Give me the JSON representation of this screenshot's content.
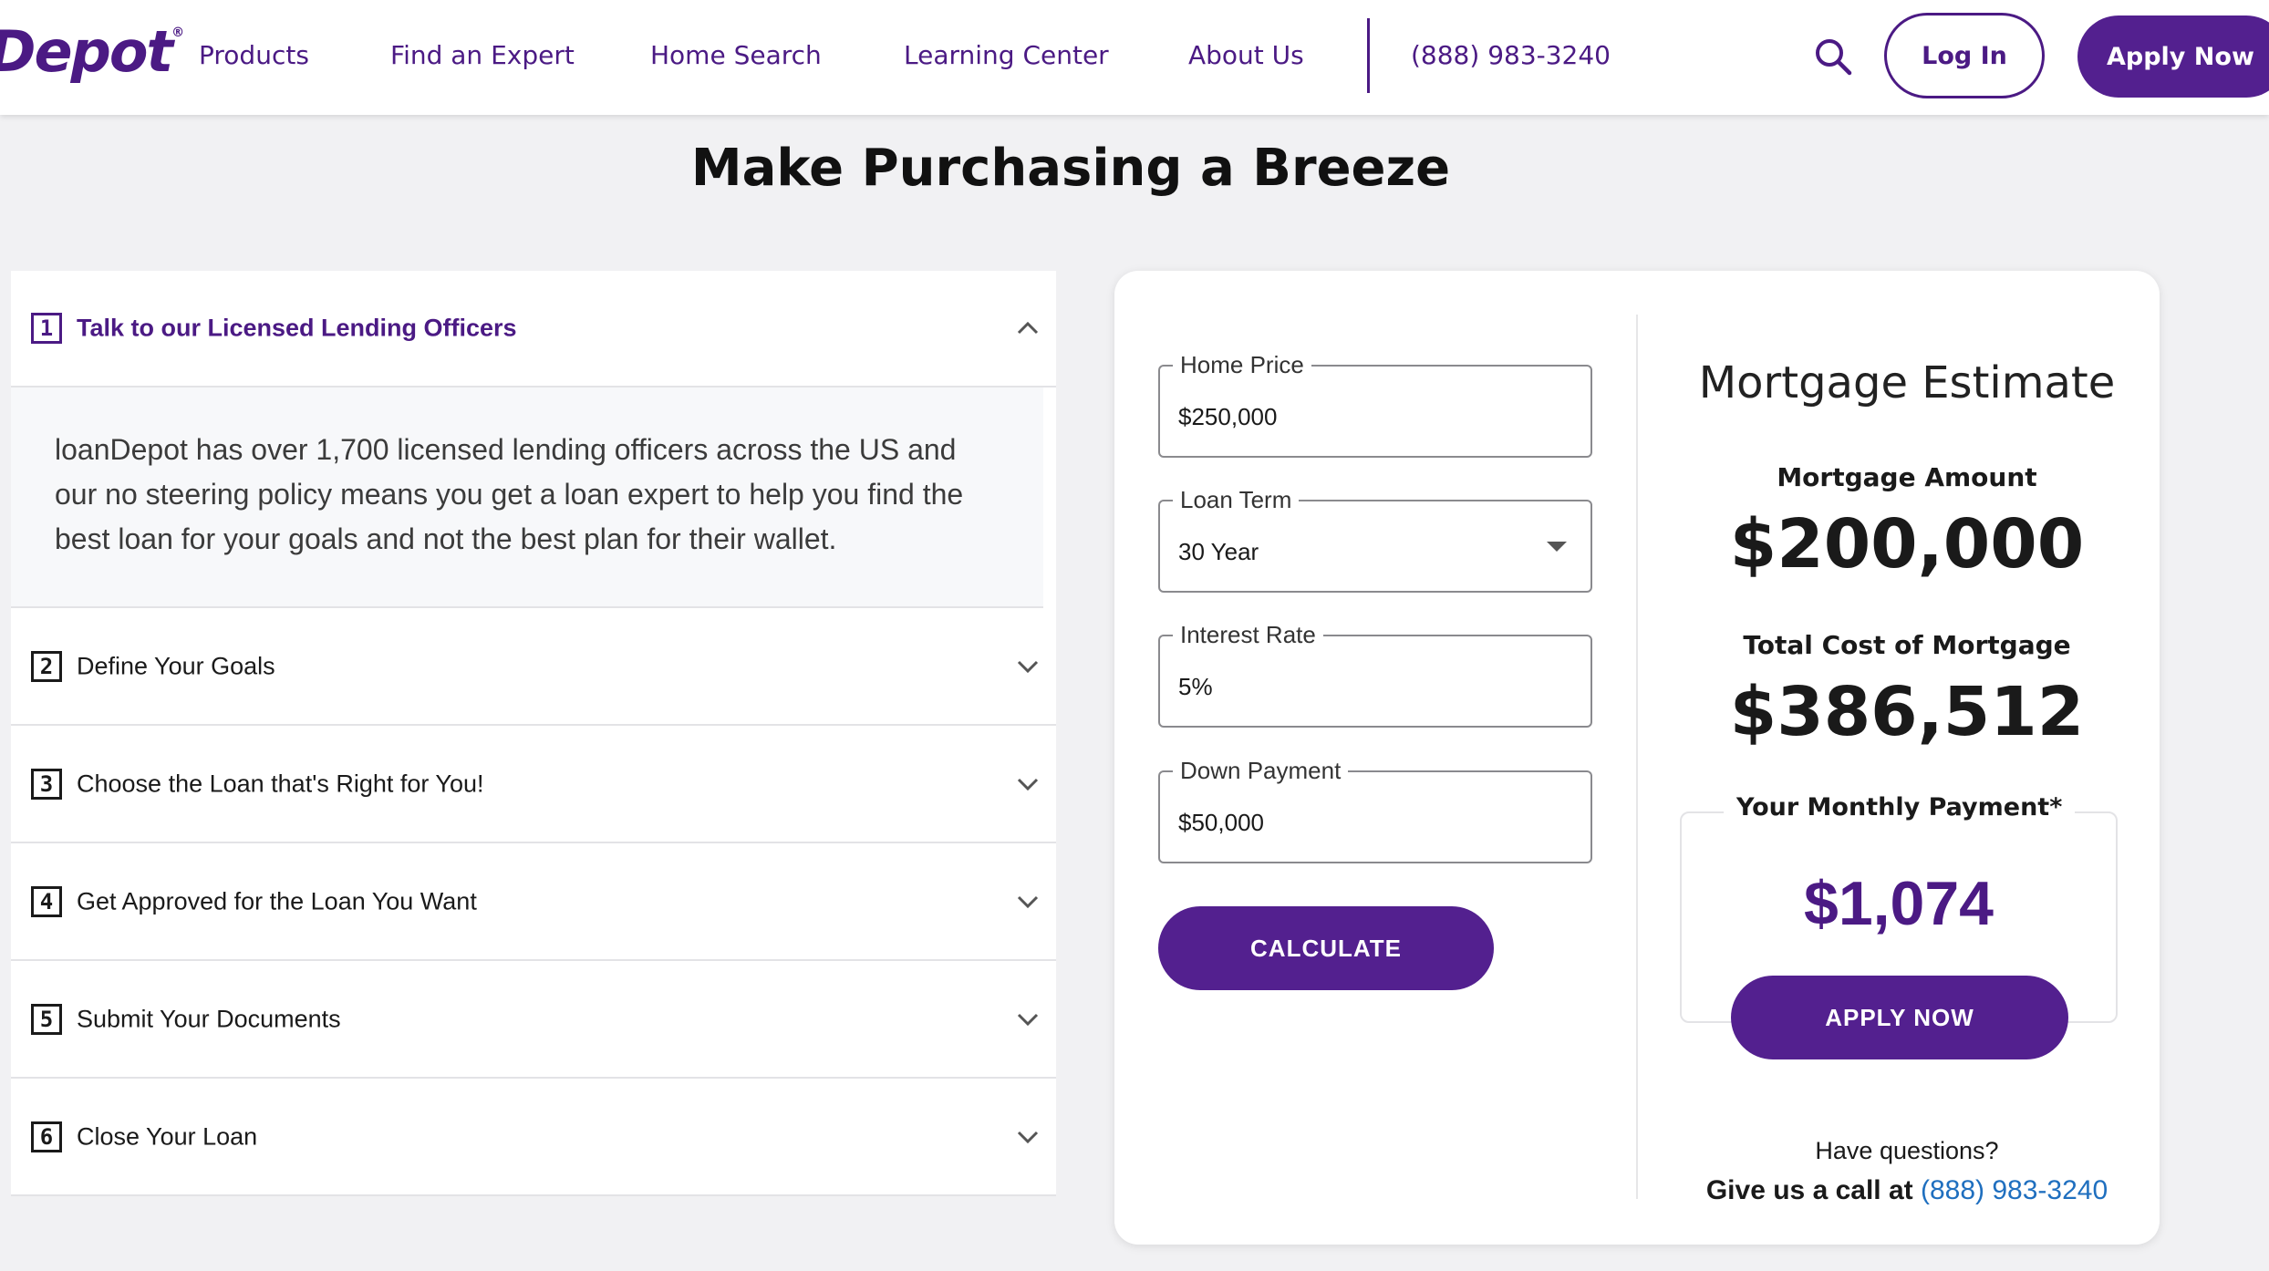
{
  "header": {
    "logo_text": "Depot",
    "logo_mark": "®",
    "nav": [
      "Products",
      "Find an Expert",
      "Home Search",
      "Learning Center",
      "About Us"
    ],
    "phone": "(888) 983-3240",
    "login_label": "Log In",
    "apply_label": "Apply Now"
  },
  "page_title": "Make Purchasing a Breeze",
  "accordion": {
    "steps": [
      {
        "num": "1",
        "title": "Talk to our Licensed Lending Officers",
        "expanded": true,
        "body": "loanDepot has over 1,700 licensed lending officers across the US and our no steering policy means you get a loan expert to help you find the best loan for your goals and not the best plan for their wallet."
      },
      {
        "num": "2",
        "title": "Define Your Goals",
        "expanded": false
      },
      {
        "num": "3",
        "title": "Choose the Loan that's Right for You!",
        "expanded": false
      },
      {
        "num": "4",
        "title": "Get Approved for the Loan You Want",
        "expanded": false
      },
      {
        "num": "5",
        "title": "Submit Your Documents",
        "expanded": false
      },
      {
        "num": "6",
        "title": "Close Your Loan",
        "expanded": false
      }
    ]
  },
  "calculator": {
    "fields": [
      {
        "label": "Home Price",
        "value": "$250,000"
      },
      {
        "label": "Loan Term",
        "value": "30 Year"
      },
      {
        "label": "Interest Rate",
        "value": "5%"
      },
      {
        "label": "Down Payment",
        "value": "$50,000"
      }
    ],
    "calculate_label": "CALCULATE"
  },
  "estimate": {
    "title": "Mortgage Estimate",
    "amount_label": "Mortgage Amount",
    "amount_value": "$200,000",
    "total_label": "Total Cost of Mortgage",
    "total_value": "$386,512",
    "monthly_label": "Your Monthly Payment*",
    "monthly_value": "$1,074",
    "apply_label": "APPLY NOW",
    "questions": "Have questions?",
    "call_prefix": "Give us a call at",
    "call_phone": "(888) 983-3240"
  },
  "colors": {
    "brand_purple": "#53208f",
    "text_purple": "#4b1a84",
    "link_blue": "#1f6fbf"
  }
}
